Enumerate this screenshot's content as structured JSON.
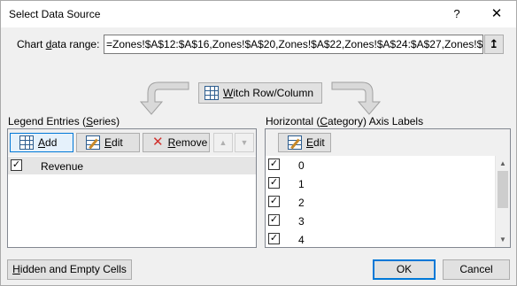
{
  "window": {
    "title": "Select Data Source",
    "help_glyph": "?",
    "close_glyph": "✕"
  },
  "range": {
    "label_pre": "Chart ",
    "label_accel": "d",
    "label_post": "ata range:",
    "value": "=Zones!$A$12:$A$16,Zones!$A$20,Zones!$A$22,Zones!$A$24:$A$27,Zones!$D$12:$",
    "collapse_glyph": "↥"
  },
  "switch": {
    "accel": "W",
    "rest": "itch Row/Column"
  },
  "legend": {
    "title_pre": "Legend Entries (",
    "title_accel": "S",
    "title_post": "eries)",
    "add_accel": "A",
    "add_rest": "dd",
    "edit_accel": "E",
    "edit_rest": "dit",
    "remove_accel": "R",
    "remove_rest": "emove",
    "up_glyph": "▲",
    "down_glyph": "▼",
    "series": [
      {
        "name": "Revenue",
        "checked": true
      }
    ]
  },
  "axis": {
    "title_pre": "Horizontal (",
    "title_accel": "C",
    "title_post": "ategory) Axis Labels",
    "edit_accel": "E",
    "edit_rest": "dit",
    "items": [
      {
        "label": "0",
        "checked": true
      },
      {
        "label": "1",
        "checked": true
      },
      {
        "label": "2",
        "checked": true
      },
      {
        "label": "3",
        "checked": true
      },
      {
        "label": "4",
        "checked": true
      }
    ],
    "scroll_up_glyph": "▲",
    "scroll_down_glyph": "▼"
  },
  "footer": {
    "hidden_accel": "H",
    "hidden_rest": "idden and Empty Cells",
    "ok": "OK",
    "cancel": "Cancel"
  },
  "colors": {
    "accent": "#0078d7",
    "selected_row": "#e5e5e5",
    "arrow_fill": "#d9d9d9",
    "arrow_stroke": "#a0a0a0",
    "remove_icon": "#d0312d"
  }
}
